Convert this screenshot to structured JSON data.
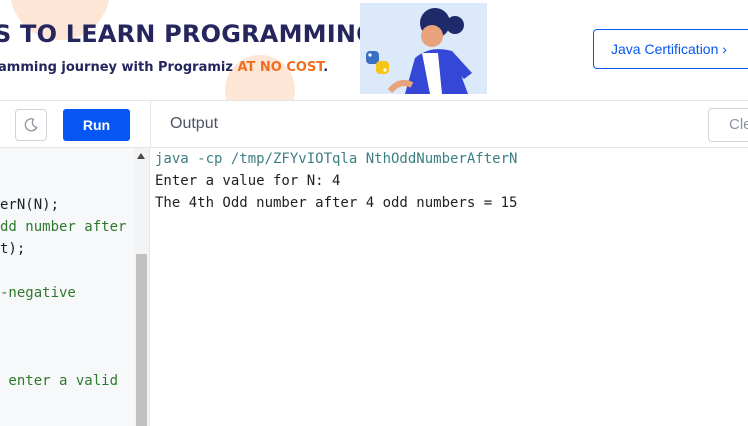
{
  "banner": {
    "title": "S TO LEARN PROGRAMMING?",
    "subtitle_prefix": "amming journey with Programiz ",
    "subtitle_highlight": "AT NO COST",
    "subtitle_suffix": ".",
    "cta_label": "Java Certification ›",
    "colors": {
      "navy": "#25265e",
      "orange": "#f26d20",
      "blue": "#0556f3"
    }
  },
  "toolbar": {
    "theme_icon": "moon-icon",
    "run_label": "Run",
    "output_label": "Output",
    "clear_label": "Cle"
  },
  "editor": {
    "lines": [
      {
        "text": "",
        "kind": "black"
      },
      {
        "text": "",
        "kind": "black"
      },
      {
        "text": "erN(N);",
        "kind": "black"
      },
      {
        "text": "dd number after",
        "kind": "green"
      },
      {
        "text": "t);",
        "kind": "black"
      },
      {
        "text": "",
        "kind": "black"
      },
      {
        "text": "-negative",
        "kind": "green"
      },
      {
        "text": "",
        "kind": "black"
      },
      {
        "text": "",
        "kind": "black"
      },
      {
        "text": "",
        "kind": "black"
      },
      {
        "text": " enter a valid",
        "kind": "green"
      }
    ]
  },
  "output": {
    "command": "java -cp /tmp/ZFYvIOTqla NthOddNumberAfterN",
    "lines": [
      "Enter a value for N: 4",
      "The 4th Odd number after 4 odd numbers = 15"
    ]
  }
}
